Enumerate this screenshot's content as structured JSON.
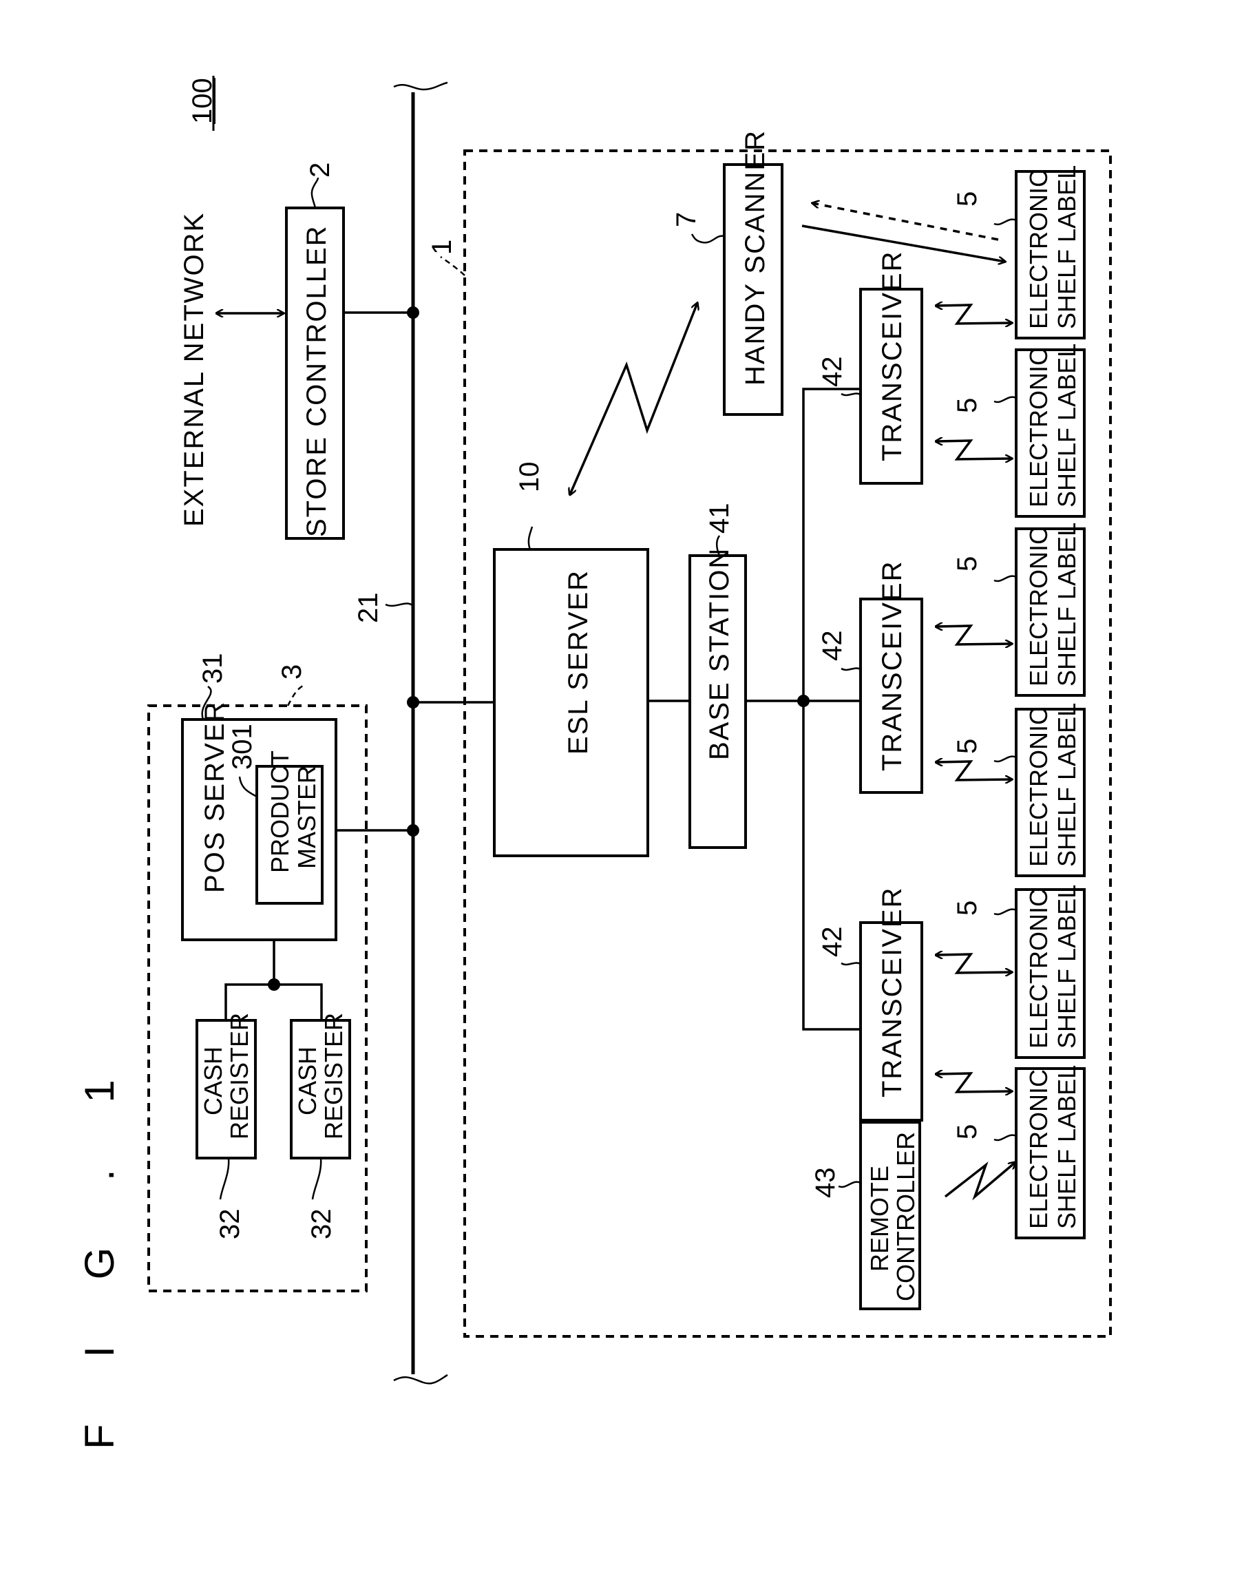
{
  "figure": {
    "title": "F I G . 1",
    "system_ref": "100"
  },
  "nodes": {
    "external_network": {
      "label": "EXTERNAL NETWORK"
    },
    "store_controller": {
      "label": "STORE CONTROLLER",
      "ref": "2"
    },
    "network_bus": {
      "ref": "21"
    },
    "pos_system": {
      "ref": "3"
    },
    "pos_server": {
      "label": "POS SERVER",
      "ref": "31"
    },
    "product_master": {
      "line1": "PRODUCT",
      "line2": "MASTER",
      "ref": "301"
    },
    "cash_registers": [
      {
        "line1": "CASH",
        "line2": "REGISTER",
        "ref": "32"
      },
      {
        "line1": "CASH",
        "line2": "REGISTER",
        "ref": "32"
      }
    ],
    "esl_system": {
      "ref": "1"
    },
    "esl_server": {
      "label": "ESL SERVER",
      "ref": "10"
    },
    "base_station": {
      "label": "BASE STATION",
      "ref": "41"
    },
    "handy_scanner": {
      "label": "HANDY SCANNER",
      "ref": "7"
    },
    "transceivers": [
      {
        "label": "TRANSCEIVER",
        "ref": "42"
      },
      {
        "label": "TRANSCEIVER",
        "ref": "42"
      },
      {
        "label": "TRANSCEIVER",
        "ref": "42"
      }
    ],
    "remote_controller": {
      "line1": "REMOTE",
      "line2": "CONTROLLER",
      "ref": "43"
    },
    "shelf_labels": [
      {
        "line1": "ELECTRONIC",
        "line2": "SHELF LABEL",
        "ref": "5"
      },
      {
        "line1": "ELECTRONIC",
        "line2": "SHELF LABEL",
        "ref": "5"
      },
      {
        "line1": "ELECTRONIC",
        "line2": "SHELF LABEL",
        "ref": "5"
      },
      {
        "line1": "ELECTRONIC",
        "line2": "SHELF LABEL",
        "ref": "5"
      },
      {
        "line1": "ELECTRONIC",
        "line2": "SHELF LABEL",
        "ref": "5"
      },
      {
        "line1": "ELECTRONIC",
        "line2": "SHELF LABEL",
        "ref": "5"
      }
    ]
  }
}
